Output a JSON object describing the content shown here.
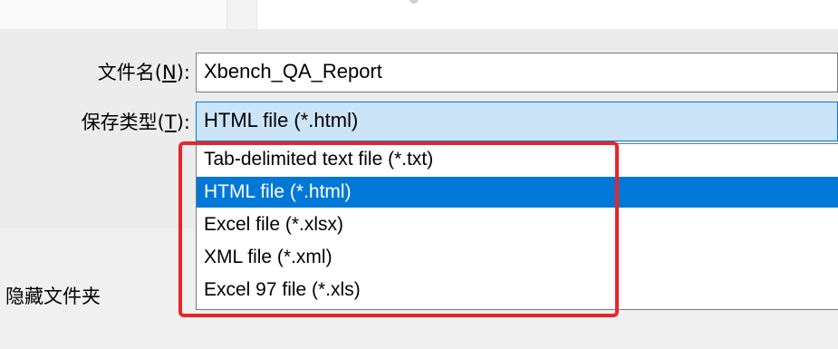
{
  "form": {
    "filename_label": "文件名(",
    "filename_mnemonic": "N",
    "filename_label_end": "):",
    "filename_value": "Xbench_QA_Report",
    "savetype_label": "保存类型(",
    "savetype_mnemonic": "T",
    "savetype_label_end": "):",
    "savetype_value": "HTML file (*.html)"
  },
  "dropdown": {
    "options": [
      {
        "label": "Tab-delimited text file (*.txt)",
        "selected": false
      },
      {
        "label": "HTML file (*.html)",
        "selected": true
      },
      {
        "label": "Excel file (*.xlsx)",
        "selected": false
      },
      {
        "label": "XML file (*.xml)",
        "selected": false
      },
      {
        "label": "Excel 97 file (*.xls)",
        "selected": false
      }
    ]
  },
  "footer": {
    "hide_folders_label": "隐藏文件夹"
  },
  "colors": {
    "selection": "#0078d7",
    "field_focus": "#cce4f7",
    "highlight_box": "#e8262a"
  }
}
